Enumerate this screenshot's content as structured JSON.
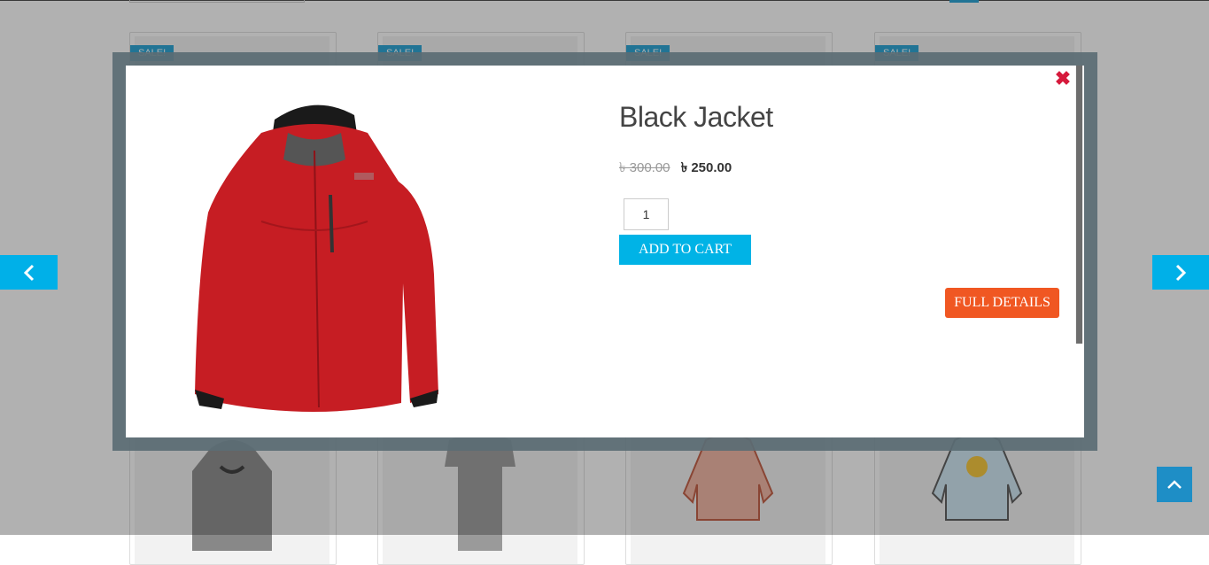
{
  "background": {
    "sale_badges": [
      "SALE!",
      "SALE!",
      "SALE!",
      "SALE!"
    ]
  },
  "modal": {
    "title": "Black Jacket",
    "price_old": "৳ 300.00",
    "price_new": "৳ 250.00",
    "quantity": "1",
    "add_to_cart_label": "ADD TO CART",
    "full_details_label": "FULL DETAILS",
    "close_icon": "close-icon",
    "image_icon": "red-jacket-image"
  },
  "navigation": {
    "prev_icon": "chevron-left-icon",
    "next_icon": "chevron-right-icon",
    "back_to_top_icon": "chevron-up-icon"
  },
  "colors": {
    "accent": "#00b3e6",
    "full_details": "#f05722",
    "close": "#d61a3c",
    "sale_badge": "#1fa0d4"
  }
}
